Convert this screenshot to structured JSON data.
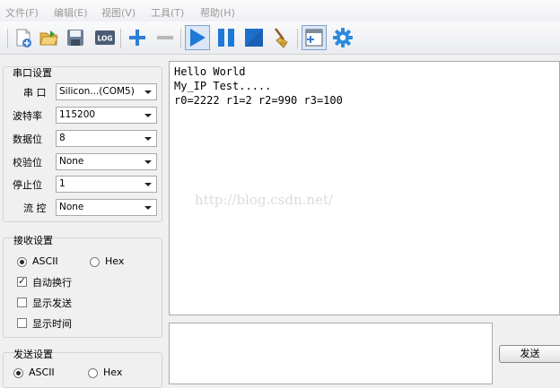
{
  "menu": {
    "file": "文件(F)",
    "edit": "编辑(E)",
    "view": "视图(V)",
    "tools": "工具(T)",
    "help": "帮助(H)"
  },
  "toolbar": {
    "log_label": "LOG",
    "buttons": [
      "new-icon",
      "open-icon",
      "save-icon",
      "log-icon",
      "add-icon",
      "remove-icon",
      "play-icon",
      "pause-icon",
      "stop-icon",
      "clear-icon",
      "window-icon",
      "settings-icon"
    ]
  },
  "serial": {
    "title": "串口设置",
    "port_label": "串 口",
    "port_value": "Silicon...(COM5)",
    "baud_label": "波特率",
    "baud_value": "115200",
    "databits_label": "数据位",
    "databits_value": "8",
    "parity_label": "校验位",
    "parity_value": "None",
    "stopbits_label": "停止位",
    "stopbits_value": "1",
    "flow_label": "流 控",
    "flow_value": "None"
  },
  "receive_settings": {
    "title": "接收设置",
    "ascii": "ASCII",
    "hex": "Hex",
    "auto_wrap": "自动换行",
    "show_send": "显示发送",
    "show_time": "显示时间",
    "mode": "ASCII",
    "auto_wrap_checked": true,
    "show_send_checked": false,
    "show_time_checked": false
  },
  "send_settings": {
    "title": "发送设置",
    "ascii": "ASCII",
    "hex": "Hex",
    "mode": "ASCII"
  },
  "receive_area": {
    "lines": [
      "Hello World",
      "My_IP Test.....",
      "r0=2222 r1=2 r2=990 r3=100"
    ],
    "watermark": "http://blog.csdn.net/"
  },
  "send_area": {
    "value": "",
    "button_label": "发送"
  },
  "colors": {
    "accent": "#2c6fcf",
    "toolbar_blue": "#1e78d8"
  }
}
